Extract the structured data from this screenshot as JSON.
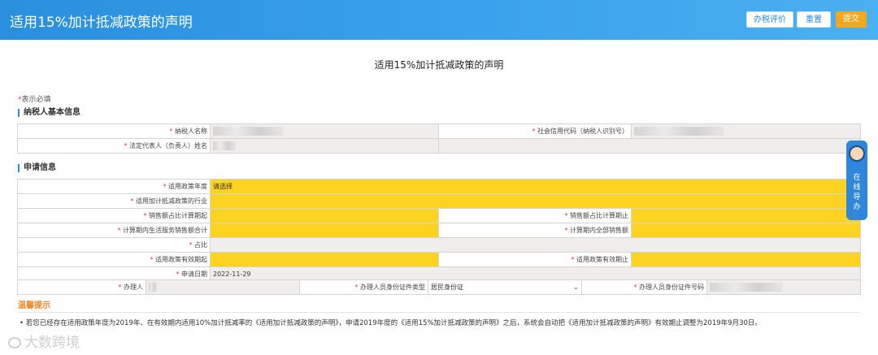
{
  "header": {
    "title": "适用15%加计抵减政策的声明",
    "buttons": {
      "evaluate": "办税评价",
      "reset": "重置",
      "submit": "提交"
    }
  },
  "form_title": "适用15%加计抵减政策的声明",
  "required_note": {
    "star": "*",
    "text": "表示必填"
  },
  "section_taxpayer": "纳税人基本信息",
  "taxpayer": {
    "name_label": "纳税人名称",
    "credit_code_label": "社会信用代码（纳税人识别号）",
    "legal_rep_label": "法定代表人（负责人）姓名"
  },
  "section_apply": "申请信息",
  "apply": {
    "policy_year_label": "适用政策年度",
    "policy_year_value": "请选择",
    "industry_label": "适用加计抵减政策的行业",
    "sales_start_label": "销售额占比计算期起",
    "sales_end_label": "销售额占比计算期止",
    "service_sales_label": "计算期内生活服务销售额合计",
    "total_sales_label": "计算期内全部销售额",
    "ratio_label": "占比",
    "valid_start_label": "适用政策有效期起",
    "valid_end_label": "适用政策有效期止",
    "apply_date_label": "申请日期",
    "apply_date_value": "2022-11-29",
    "handler_label": "办理人",
    "id_type_label": "办理人员身份证件类型",
    "id_type_value": "居民身份证",
    "id_number_label": "办理人员身份证件号码"
  },
  "tip": {
    "title": "温馨提示",
    "text": "• 若您已经存在适用政策年度为2019年、在有效期内适用10%加计抵减率的《适用加计抵减政策的声明》，申请2019年度的《适用15%加计抵减政策的声明》之后，系统会自动把《适用加计抵减政策的声明》有效期止调整为2019年9月30日。"
  },
  "helper": {
    "text": "在线导办"
  },
  "watermark": "大数跨境",
  "colors": {
    "header": "#3aa2ec",
    "required_field": "#fdd321",
    "accent": "#2b8ae0",
    "tip": "#e8892a"
  }
}
